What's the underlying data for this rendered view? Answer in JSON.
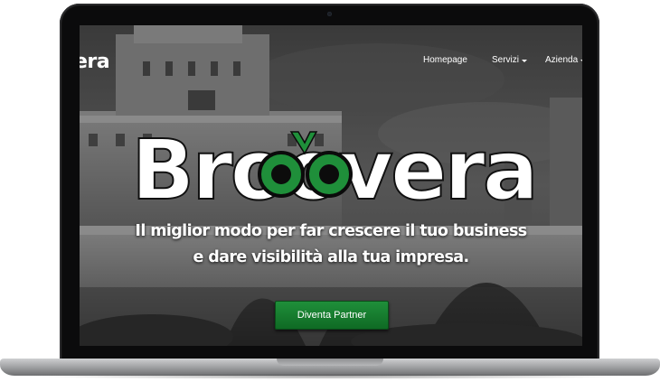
{
  "nav": {
    "brand": "era",
    "items": [
      {
        "label": "Homepage",
        "has_dropdown": false
      },
      {
        "label": "Servizi",
        "has_dropdown": true
      },
      {
        "label": "Azienda",
        "has_dropdown": true
      }
    ]
  },
  "hero": {
    "logo_text": "Broovera",
    "tagline_line1": "Il miglior modo per far crescere il tuo business",
    "tagline_line2": "e dare visibilità alla tua impresa.",
    "cta_label": "Diventa Partner"
  },
  "colors": {
    "accent_green": "#1f8f3a",
    "text": "#ffffff",
    "laptop_frame": "#0b0b0c"
  }
}
